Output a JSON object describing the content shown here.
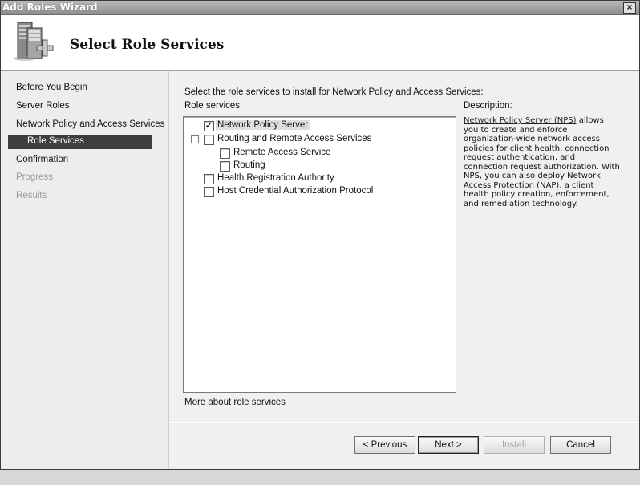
{
  "window": {
    "title": "Add Roles Wizard",
    "close_glyph": "×"
  },
  "header": {
    "icon": "server-roles-icon",
    "title": "Select Role Services"
  },
  "nav": {
    "items": [
      {
        "label": "Before You Begin",
        "state": "normal"
      },
      {
        "label": "Server Roles",
        "state": "normal"
      },
      {
        "label": "Network Policy and Access Services",
        "state": "normal"
      },
      {
        "label": "Role Services",
        "state": "selected"
      },
      {
        "label": "Confirmation",
        "state": "normal"
      },
      {
        "label": "Progress",
        "state": "disabled"
      },
      {
        "label": "Results",
        "state": "disabled"
      }
    ]
  },
  "content": {
    "instruction": "Select the role services to install for Network Policy and Access Services:",
    "role_services_label": "Role services:",
    "tree": [
      {
        "label": "Network Policy Server",
        "checked": true,
        "highlighted": true
      },
      {
        "label": "Routing and Remote Access Services",
        "checked": false,
        "expanded": true
      },
      {
        "label": "Remote Access Service",
        "checked": false
      },
      {
        "label": "Routing",
        "checked": false
      },
      {
        "label": "Health Registration Authority",
        "checked": false
      },
      {
        "label": "Host Credential Authorization Protocol",
        "checked": false
      }
    ],
    "description_label": "Description:",
    "description_link": "Network Policy Server (NPS)",
    "description_text": " allows you to create and enforce organization-wide network access policies for client health, connection request authentication, and connection request authorization. With NPS, you can also deploy Network Access Protection (NAP), a client health policy creation, enforcement, and remediation technology.",
    "more_link": "More about role services",
    "check_glyph": "✓",
    "expander_glyph": "minus"
  },
  "buttons": {
    "previous": "< Previous",
    "next": "Next >",
    "install": "Install",
    "cancel": "Cancel"
  }
}
